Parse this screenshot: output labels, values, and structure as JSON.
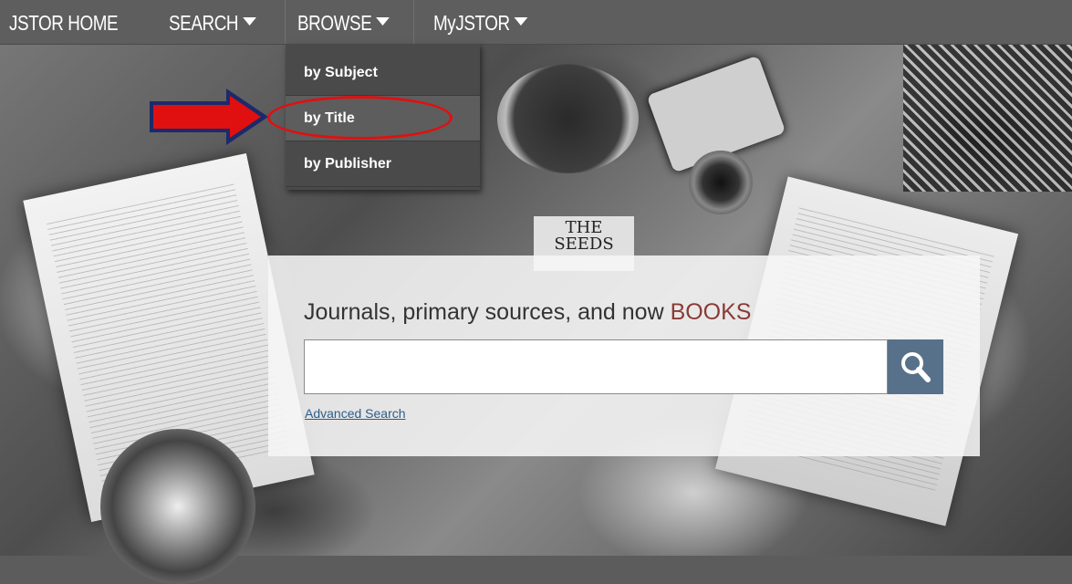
{
  "nav": {
    "items": [
      {
        "label": "JSTOR HOME",
        "has_caret": false
      },
      {
        "label": "SEARCH",
        "has_caret": true
      },
      {
        "label": "BROWSE",
        "has_caret": true
      },
      {
        "label": "MyJSTOR",
        "has_caret": true
      }
    ]
  },
  "browse_menu": {
    "items": [
      {
        "label": "by Subject"
      },
      {
        "label": "by Title",
        "highlighted": true
      },
      {
        "label": "by Publisher"
      }
    ]
  },
  "background": {
    "book_title": "THE SEEDS"
  },
  "search": {
    "headline_prefix": "Journals, primary sources, and now ",
    "headline_accent": "BOOKS",
    "input_value": "",
    "button_icon": "search-icon",
    "advanced_link": "Advanced Search"
  },
  "annotation": {
    "arrow_color": "#e01010",
    "arrow_outline_color": "#1c2a6b",
    "circle_color": "#e01010"
  },
  "colors": {
    "nav_bg": "#5e5e5e",
    "accent": "#8b3a36",
    "search_button": "#58718a",
    "link": "#2c5d8a"
  }
}
